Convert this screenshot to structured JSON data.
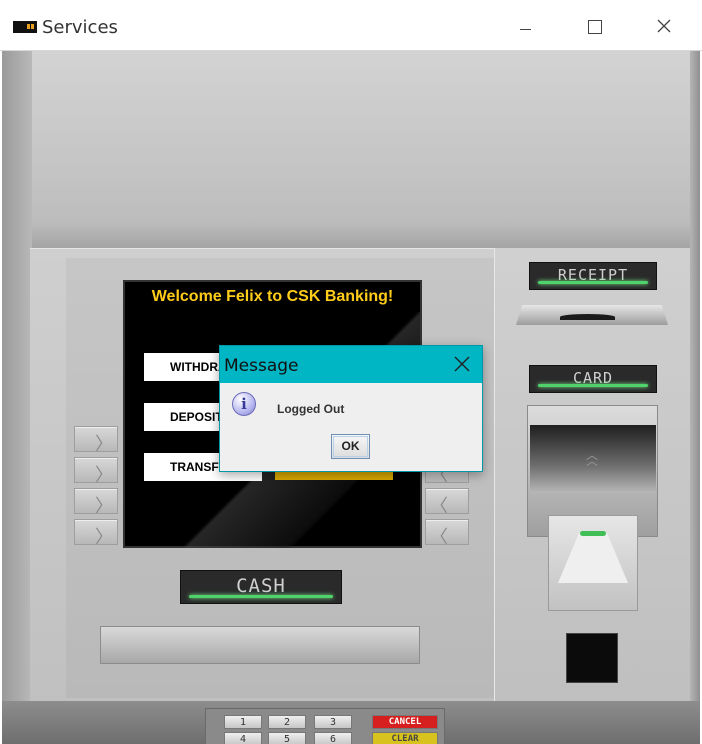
{
  "window": {
    "title": "Services",
    "controls": {
      "minimize": "minimize",
      "maximize": "maximize",
      "close": "close"
    }
  },
  "atm": {
    "screen": {
      "welcome": "Welcome Felix to CSK Banking!",
      "menu": [
        {
          "label": "WITHDRAW"
        },
        {
          "label": "DEPOSIT"
        },
        {
          "label": "TRANSFER"
        }
      ]
    },
    "labels": {
      "receipt": "RECEIPT",
      "card": "CARD",
      "cash": "CASH"
    },
    "keypad": {
      "row1": [
        "1",
        "2",
        "3",
        "CANCEL"
      ],
      "row2": [
        "4",
        "5",
        "6",
        "CLEAR"
      ]
    },
    "colors": {
      "welcome_text": "#ffcc1a",
      "led_green": "#4fd36a",
      "cancel_key": "#d62020",
      "clear_key": "#d8c21e"
    }
  },
  "dialog": {
    "title": "Message",
    "message": "Logged Out",
    "ok_label": "OK",
    "icon": "info-icon",
    "accent": "#00b5c4"
  }
}
